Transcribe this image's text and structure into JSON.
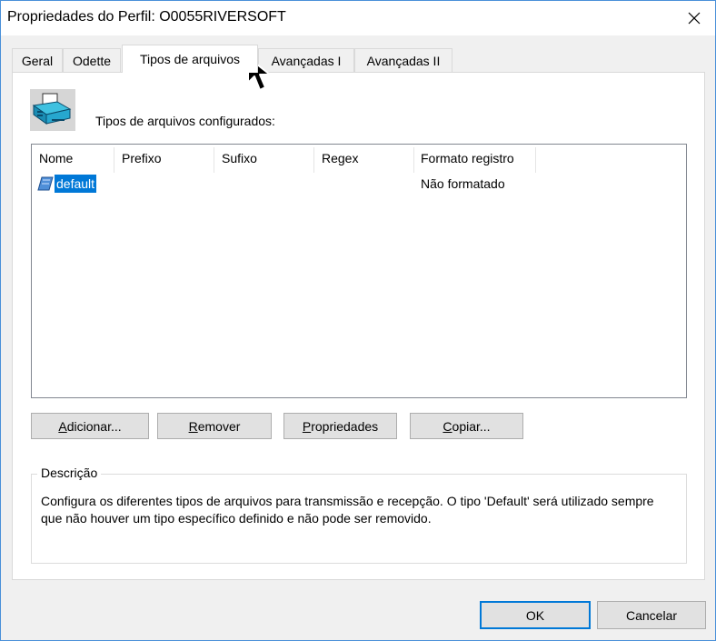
{
  "window": {
    "title": "Propriedades do Perfil: O0055RIVERSOFT",
    "close_glyph": "✕"
  },
  "tabs": [
    {
      "label": "Geral"
    },
    {
      "label": "Odette"
    },
    {
      "label": "Tipos de arquivos",
      "active": true
    },
    {
      "label": "Avançadas I"
    },
    {
      "label": "Avançadas II"
    }
  ],
  "panel": {
    "section_label": "Tipos de arquivos configurados:",
    "icon": "printer-files-icon"
  },
  "list": {
    "columns": [
      "Nome",
      "Prefixo",
      "Sufixo",
      "Regex",
      "Formato registro"
    ],
    "rows": [
      {
        "nome": "default",
        "prefixo": "",
        "sufixo": "",
        "regex": "",
        "formato": "Não formatado",
        "icon": "file-type-icon",
        "selected": true
      }
    ]
  },
  "buttons": {
    "add": {
      "accel": "A",
      "rest": "dicionar..."
    },
    "remove": {
      "accel": "R",
      "rest": "emover"
    },
    "properties": {
      "accel": "P",
      "rest": "ropriedades"
    },
    "copy": {
      "accel": "C",
      "rest": "opiar..."
    }
  },
  "description": {
    "title": "Descrição",
    "text": "Configura os diferentes tipos de arquivos para transmissão e recepção. O tipo 'Default' será utilizado sempre que não houver um tipo específico definido e não pode ser removido."
  },
  "footer": {
    "ok": "OK",
    "cancel": "Cancelar"
  },
  "colors": {
    "selection": "#0078d7",
    "accent_border": "#0078d7"
  }
}
